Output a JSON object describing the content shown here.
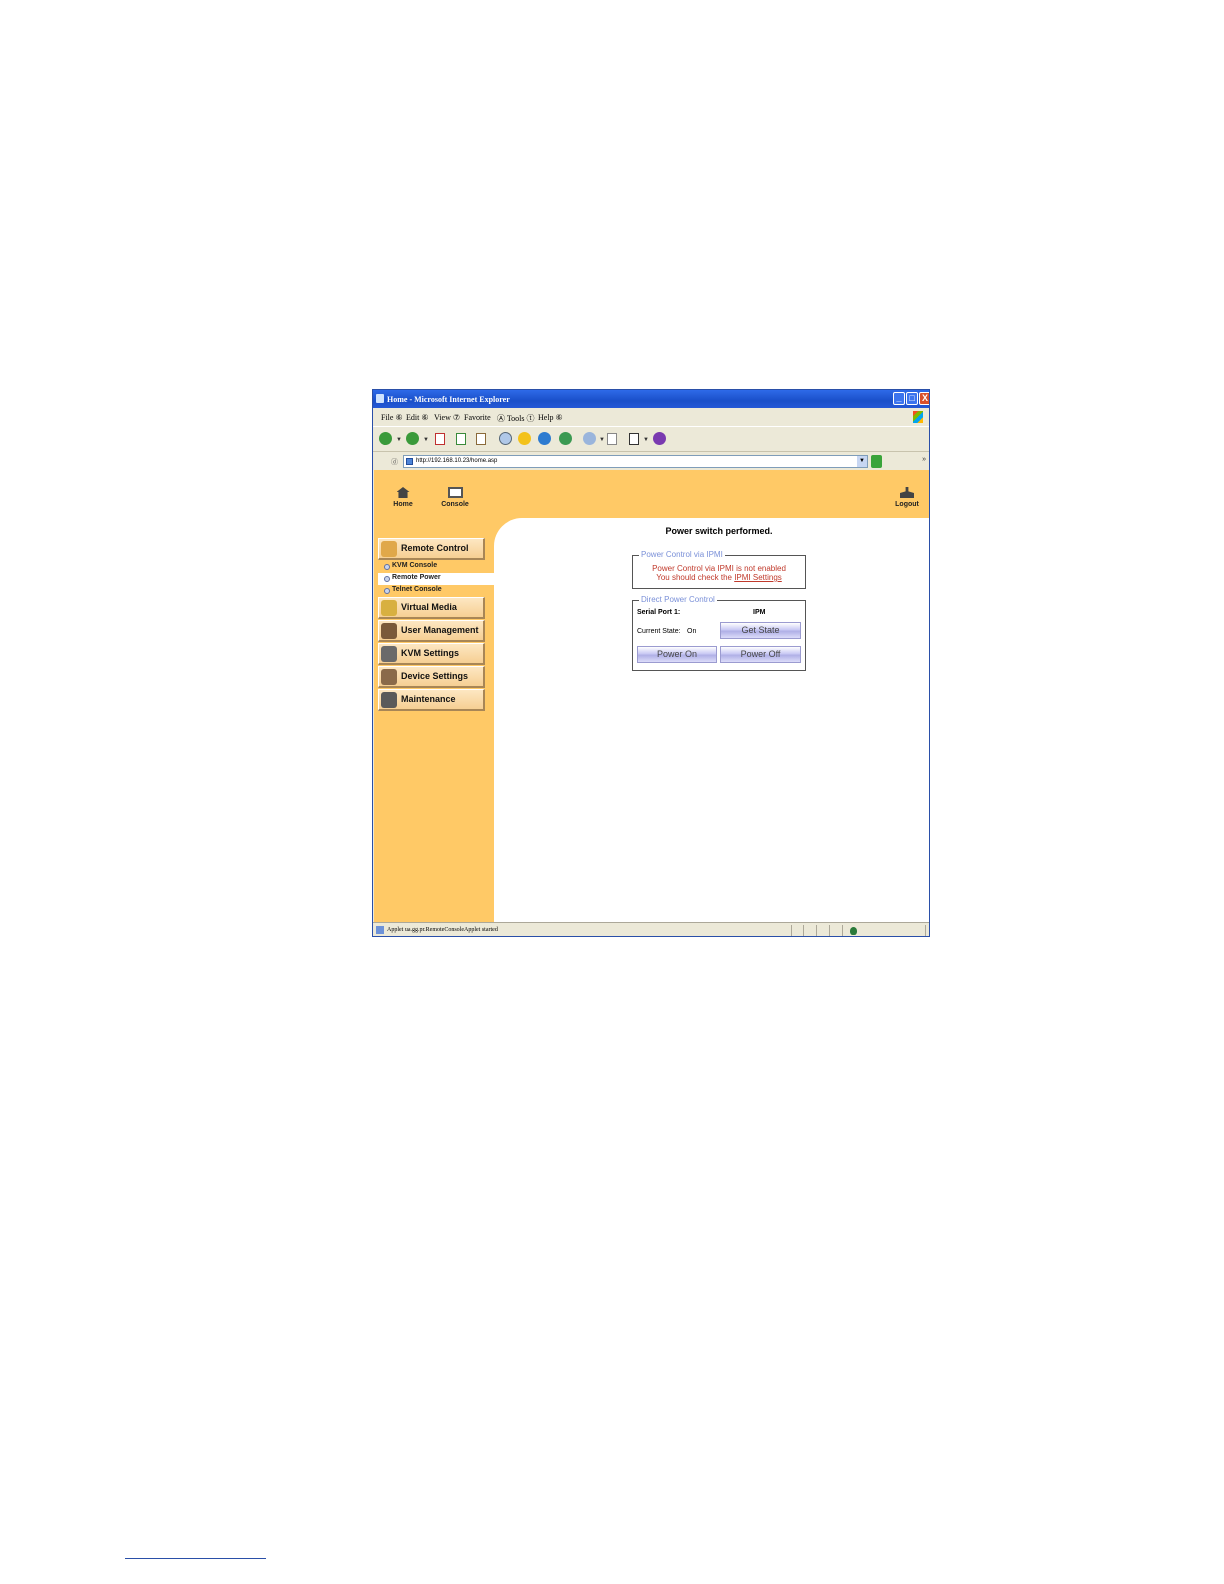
{
  "window": {
    "title": "Home - Microsoft Internet Explorer"
  },
  "menu": [
    "File ⑥",
    "Edit ⑥",
    "View ⑦",
    "Favorite",
    "Ⓐ Tools ⓣ",
    "Help ⑥"
  ],
  "address": {
    "label": "ⓓ",
    "url": "http://192.168.10.23/home.asp"
  },
  "toolbar_more": "»",
  "top_nav": {
    "home": "Home",
    "console": "Console",
    "logout": "Logout"
  },
  "sidebar": {
    "remote_control": "Remote Control",
    "sub_items": [
      "KVM Console",
      "Remote Power",
      "Telnet Console"
    ],
    "items": [
      "Virtual Media",
      "User Management",
      "KVM Settings",
      "Device Settings",
      "Maintenance"
    ]
  },
  "main": {
    "message": "Power switch performed.",
    "ipmi_box": {
      "legend": "Power Control via IPMI",
      "line1": "Power Control via IPMI is not enabled",
      "line2_prefix": "You should check the ",
      "link": "IPMI Settings"
    },
    "direct_box": {
      "legend": "Direct Power Control",
      "serial_label": "Serial Port 1:",
      "serial_value": "IPM",
      "state_label": "Current State:",
      "state_value": "On",
      "get_state": "Get State",
      "power_on": "Power On",
      "power_off": "Power Off"
    }
  },
  "status": {
    "text": "Applet ua.gg.pr.RemoteConsoleApplet started"
  }
}
